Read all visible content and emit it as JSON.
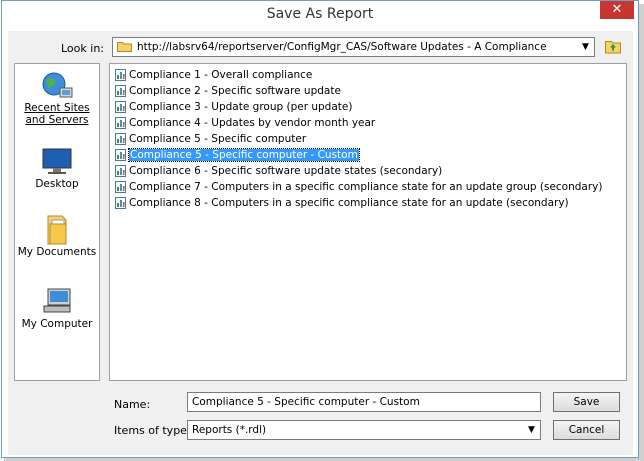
{
  "window": {
    "title": "Save As Report",
    "close_glyph": "✕"
  },
  "lookin": {
    "label": "Look in:",
    "path": "http://labsrv64/reportserver/ConfigMgr_CAS/Software Updates - A Compliance",
    "arrow": "▼"
  },
  "places": [
    {
      "label": "Recent Sites and Servers",
      "icon": "globe-network-icon"
    },
    {
      "label": "Desktop",
      "icon": "desktop-icon"
    },
    {
      "label": "My Documents",
      "icon": "folder-documents-icon"
    },
    {
      "label": "My Computer",
      "icon": "computer-icon"
    }
  ],
  "files": [
    {
      "label": "Compliance 1 - Overall compliance"
    },
    {
      "label": "Compliance 2 - Specific software update"
    },
    {
      "label": "Compliance 3 - Update group (per update)"
    },
    {
      "label": "Compliance 4 - Updates by vendor month year"
    },
    {
      "label": "Compliance 5 - Specific computer"
    },
    {
      "label": "Compliance 5 - Specific computer - Custom",
      "selected": true
    },
    {
      "label": "Compliance 6 - Specific software update states (secondary)"
    },
    {
      "label": "Compliance 7 - Computers in a specific compliance state for an update group (secondary)"
    },
    {
      "label": "Compliance 8 - Computers in a specific compliance state for an update (secondary)"
    }
  ],
  "form": {
    "name_label": "Name:",
    "name_value": "Compliance 5 - Specific computer - Custom",
    "type_label": "Items of type:",
    "type_value": "Reports (*.rdl)",
    "type_arrow": "▼"
  },
  "buttons": {
    "save": "Save",
    "cancel": "Cancel"
  },
  "colors": {
    "selection": "#3399ff",
    "close": "#c7372f",
    "border": "#6aa0c8"
  }
}
